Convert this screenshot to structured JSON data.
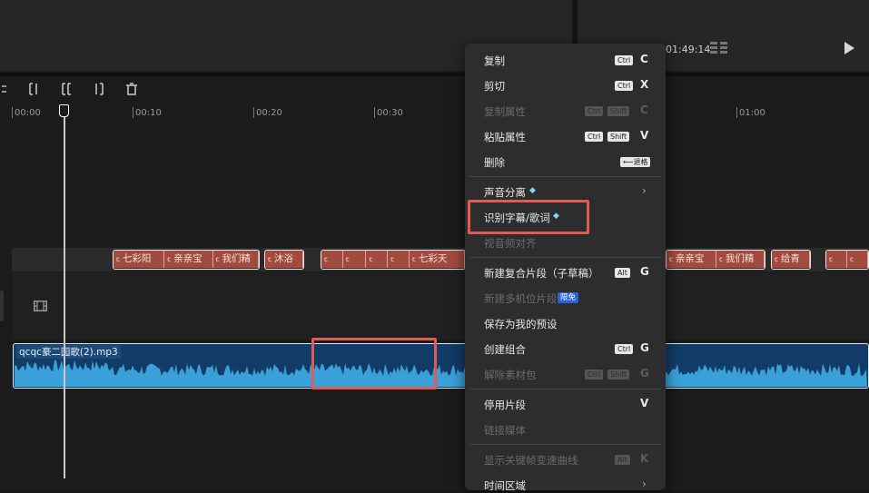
{
  "preview": {
    "timecode": "01:49:14"
  },
  "ruler": {
    "labels": [
      "00:00",
      "00:10",
      "00:20",
      "00:30",
      "01:00"
    ]
  },
  "subtitles": {
    "clips": [
      "七彩阳",
      "亲亲宝",
      "我们精",
      "沐浴",
      "七彩天",
      "亲亲宝",
      "我们精",
      "给青"
    ],
    "icon": "ꞇ̈"
  },
  "audio": {
    "filename": "qcqc豪二园歌(2).mp3"
  },
  "menu": {
    "copy": {
      "label": "复制",
      "mod": "Ctrl",
      "key": "C"
    },
    "cut": {
      "label": "剪切",
      "mod": "Ctrl",
      "key": "X"
    },
    "copy_attr": {
      "label": "复制属性",
      "mod1": "Ctrl",
      "mod2": "Shift",
      "key": "C"
    },
    "paste_attr": {
      "label": "粘贴属性",
      "mod1": "Ctrl",
      "mod2": "Shift",
      "key": "V"
    },
    "delete": {
      "label": "删除",
      "key": "⟵退格"
    },
    "audio_split": {
      "label": "声音分离"
    },
    "recognize": {
      "label": "识别字幕/歌词"
    },
    "align": {
      "label": "视音频对齐"
    },
    "compound": {
      "label": "新建复合片段（子草稿）",
      "mod": "Alt",
      "key": "G"
    },
    "multicam": {
      "label": "新建多机位片段",
      "badge": "限免"
    },
    "save_preset": {
      "label": "保存为我的预设"
    },
    "group": {
      "label": "创建组合",
      "mod": "Ctrl",
      "key": "G"
    },
    "ungroup": {
      "label": "解除素材包",
      "mod1": "Ctrl",
      "mod2": "Shift",
      "key": "G"
    },
    "disable": {
      "label": "停用片段",
      "key": "V"
    },
    "link_media": {
      "label": "链接媒体"
    },
    "keyframe_curve": {
      "label": "显示关键帧变速曲线",
      "mod": "Alt",
      "key": "K"
    },
    "time_range": {
      "label": "时间区域"
    }
  },
  "colors": {
    "accent_red": "#e25a56",
    "subtitle_clip": "#a34a3f",
    "audio_clip": "#123b67"
  }
}
